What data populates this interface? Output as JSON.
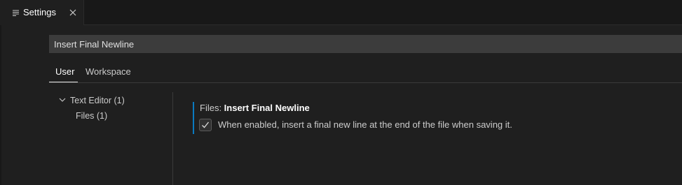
{
  "editor": {
    "tab": {
      "label": "Settings",
      "icon": "settings-file-icon",
      "close_icon": "close-icon"
    }
  },
  "search": {
    "value": "Insert Final Newline",
    "placeholder": ""
  },
  "scope_tabs": [
    {
      "label": "User",
      "active": true
    },
    {
      "label": "Workspace",
      "active": false
    }
  ],
  "toc": {
    "items": [
      {
        "label": "Text Editor (1)",
        "expanded": true
      },
      {
        "label": "Files (1)"
      }
    ]
  },
  "setting": {
    "category": "Files: ",
    "name": "Insert Final Newline",
    "checked": true,
    "description": "When enabled, insert a final new line at the end of the file when saving it."
  },
  "colors": {
    "background": "#1f1f1f",
    "focus_bar": "#0a7ac0",
    "input_background": "#3c3c3c"
  }
}
